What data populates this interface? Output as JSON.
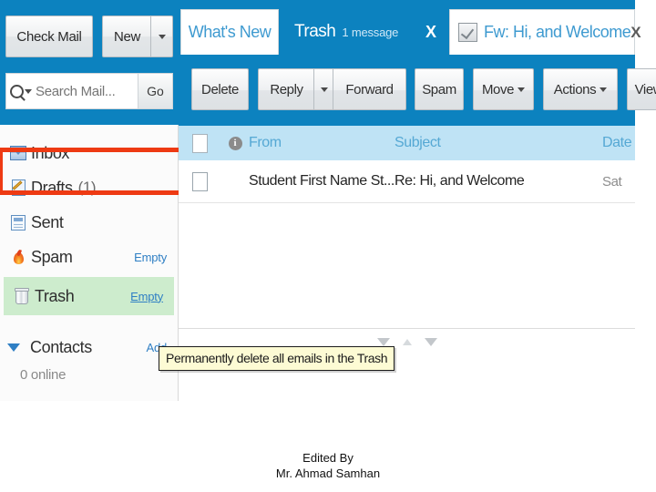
{
  "sidebar": {
    "check_mail_label": "Check Mail",
    "new_label": "New",
    "new_caret": "▾",
    "search_placeholder": "Search Mail...",
    "search_value": "",
    "go_label": "Go",
    "folders": [
      {
        "icon": "inbox-icon",
        "label": "Inbox",
        "count": "",
        "action": ""
      },
      {
        "icon": "drafts-icon",
        "label": "Drafts",
        "count": "(1)",
        "action": ""
      },
      {
        "icon": "sent-icon",
        "label": "Sent",
        "count": "",
        "action": ""
      },
      {
        "icon": "spam-icon",
        "label": "Spam",
        "count": "",
        "action": "Empty"
      },
      {
        "icon": "trash-icon",
        "label": "Trash",
        "count": "",
        "action": "Empty"
      }
    ],
    "contacts": {
      "label": "Contacts",
      "add_label": "Add",
      "online_text": "0 online"
    },
    "highlight_color": "#cdeccd",
    "callout_color": "#ee3a13",
    "accent_blue": "#0c82bf"
  },
  "tooltip": {
    "text": "Permanently delete all emails in the Trash"
  },
  "tabs": [
    {
      "label": "What's New",
      "sub": "",
      "active": false,
      "closable": false
    },
    {
      "label": "Trash",
      "sub": "1 message",
      "active": true,
      "closable": true
    },
    {
      "label": "Fw: Hi, and Welcome",
      "sub": "",
      "active": false,
      "closable": true
    }
  ],
  "toolbar": {
    "delete_label": "Delete",
    "reply_label": "Reply",
    "forward_label": "Forward",
    "spam_label": "Spam",
    "move_label": "Move",
    "actions_label": "Actions",
    "view_label": "View: All"
  },
  "message_list": {
    "columns": {
      "info": "i",
      "from": "From",
      "subject": "Subject",
      "date": "Date"
    },
    "rows": [
      {
        "from": "Student First Name St...",
        "subject": "Re: Hi, and Welcome",
        "date": "Sat "
      }
    ]
  },
  "caption": {
    "line1": "Edited By",
    "line2": "Mr. Ahmad Samhan"
  }
}
